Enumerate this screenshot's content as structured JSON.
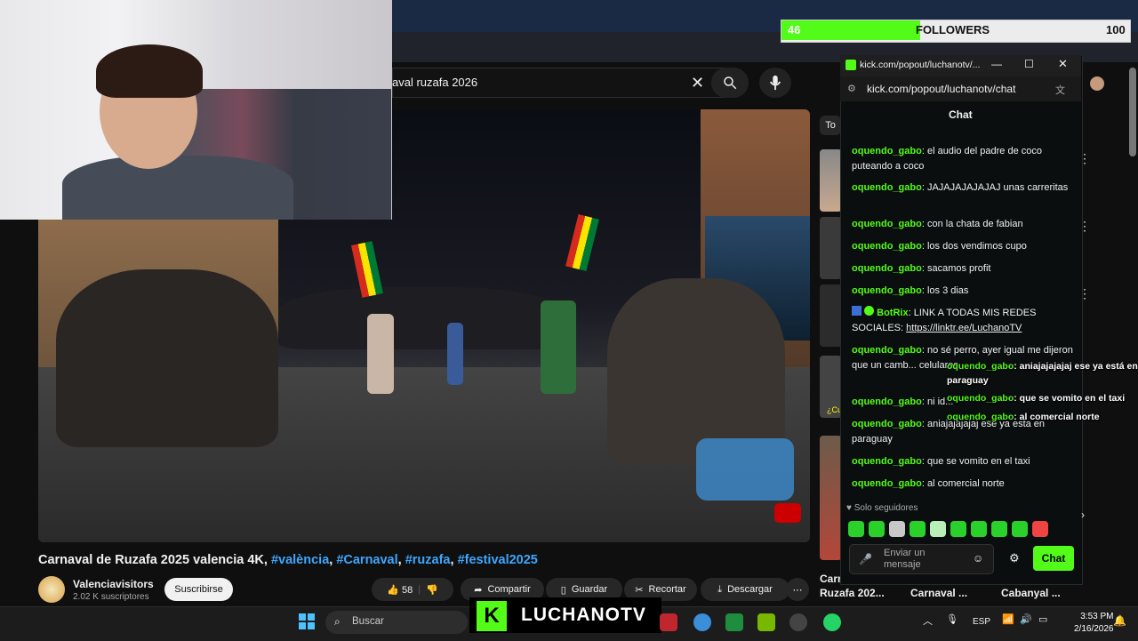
{
  "followers": {
    "current": "46",
    "label": "FOLLOWERS",
    "goal": "100",
    "progress_fraction": 0.46
  },
  "youtube": {
    "search_value": "aval ruzafa 2026",
    "video_title_main": "Carnaval de Ruzafa 2025 valencia 4K, ",
    "tags": [
      "#valència",
      "#Carnaval",
      "#ruzafa",
      "#festival2025"
    ],
    "channel_name": "Valenciavisitors",
    "subscribers": "2.02 K suscriptores",
    "subscribe_label": "Suscribirse",
    "like_count": "58",
    "share_label": "Compartir",
    "save_label": "Guardar",
    "clip_label": "Recortar",
    "download_label": "Descargar",
    "filter_chip": "To",
    "recommendations": [
      "Carn",
      "Ruzafa 202...",
      "Carnaval ...",
      "Cabanyal ..."
    ],
    "thumb_text": "¿Cu"
  },
  "chat_popup": {
    "window_title": "kick.com/popout/luchanotv/...",
    "url": "kick.com/popout/luchanotv/chat",
    "header": "Chat",
    "messages": [
      {
        "user": "oquendo_gabo",
        "text": "el audio del padre de coco puteando a coco"
      },
      {
        "user": "oquendo_gabo",
        "text": "JAJAJAJAJAJAJ unas carreritas"
      },
      {
        "user": "oquendo_gabo",
        "text": "con la chata de fabian"
      },
      {
        "user": "oquendo_gabo",
        "text": "los dos vendimos cupo"
      },
      {
        "user": "oquendo_gabo",
        "text": "sacamos profit"
      },
      {
        "user": "oquendo_gabo",
        "text": "los 3 dias"
      },
      {
        "user": "BotRix",
        "text": "LINK A TODAS MIS REDES SOCIALES: ",
        "link": "https://linktr.ee/LuchanoTV"
      },
      {
        "user": "oquendo_gabo",
        "text": "no sé perro, ayer igual me dijeron que un camb... celulares"
      },
      {
        "user": "oquendo_gabo",
        "text": "ni id..."
      },
      {
        "user": "oquendo_gabo",
        "text": "aniajajajajaj ese ya esta en paraguay"
      },
      {
        "user": "oquendo_gabo",
        "text": "que se vomito en el taxi"
      },
      {
        "user": "oquendo_gabo",
        "text": "al comercial norte"
      }
    ],
    "overlay_messages": [
      {
        "user": "oquendo_gabo",
        "text": ": aniajajajajaj ese ya está en paraguay"
      },
      {
        "user": "oquendo_gabo",
        "text": ": que se vomito en el taxi"
      },
      {
        "user": "oquendo_gabo",
        "text": ": al comercial norte"
      }
    ],
    "followers_only": "Solo seguidores",
    "input_placeholder": "Enviar un mensaje",
    "send_label": "Chat"
  },
  "taskbar": {
    "search_placeholder": "Buscar",
    "brand": "LUCHANOTV",
    "lang": "ESP",
    "time": "3:53 PM",
    "date": "2/16/2026"
  },
  "colors": {
    "kick_green": "#53fc18",
    "link_blue": "#3ea6ff",
    "yt_bg": "#0f0f0f"
  }
}
